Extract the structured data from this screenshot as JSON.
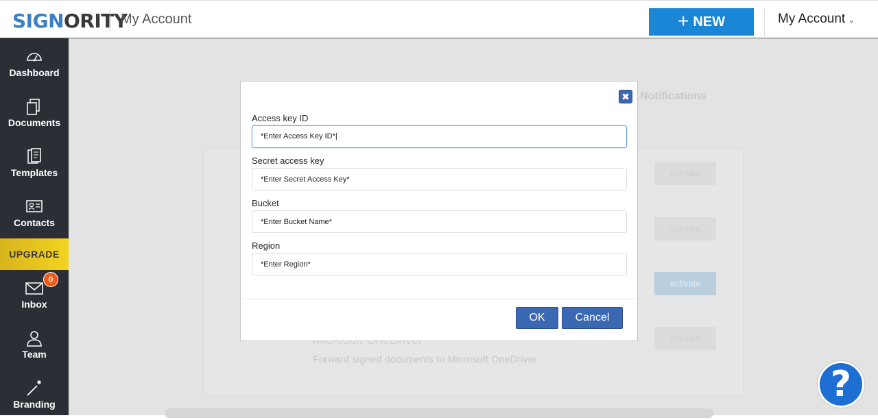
{
  "header": {
    "logo_part1": "SIGN",
    "logo_part2": "ORITY",
    "title": "My Account",
    "new_button": "NEW",
    "account_menu": "My Account"
  },
  "sidebar": {
    "items": [
      {
        "label": "Dashboard",
        "icon": "dashboard-gauge-icon"
      },
      {
        "label": "Documents",
        "icon": "documents-icon"
      },
      {
        "label": "Templates",
        "icon": "templates-icon"
      },
      {
        "label": "Contacts",
        "icon": "contacts-card-icon"
      },
      {
        "label": "Inbox",
        "icon": "inbox-envelope-icon"
      },
      {
        "label": "Team",
        "icon": "team-user-icon"
      },
      {
        "label": "Branding",
        "icon": "branding-wand-icon"
      }
    ],
    "upgrade_label": "UPGRADE",
    "inbox_badge": "0"
  },
  "background": {
    "tab_notifications": "Notifications",
    "activate_label": "activate",
    "integration_title": "Microsoft OneDriver",
    "integration_desc": "Forward signed documents to Microsoft OneDriver"
  },
  "modal": {
    "close_icon": "close-x-icon",
    "fields": [
      {
        "label": "Access key ID",
        "value": "*Enter Access Key ID*|"
      },
      {
        "label": "Secret access key",
        "placeholder": "*Enter Secret Access Key*"
      },
      {
        "label": "Bucket",
        "placeholder": "*Enter Bucket Name*"
      },
      {
        "label": "Region",
        "placeholder": "*Enter Region*"
      }
    ],
    "ok_label": "OK",
    "cancel_label": "Cancel"
  },
  "help": {
    "label": "?"
  },
  "colors": {
    "primary_blue": "#1a86d6",
    "modal_button_blue": "#3b68b3",
    "sidebar_bg": "#2b2e35",
    "upgrade_yellow": "#e6c619",
    "badge_orange": "#f05a1a"
  }
}
